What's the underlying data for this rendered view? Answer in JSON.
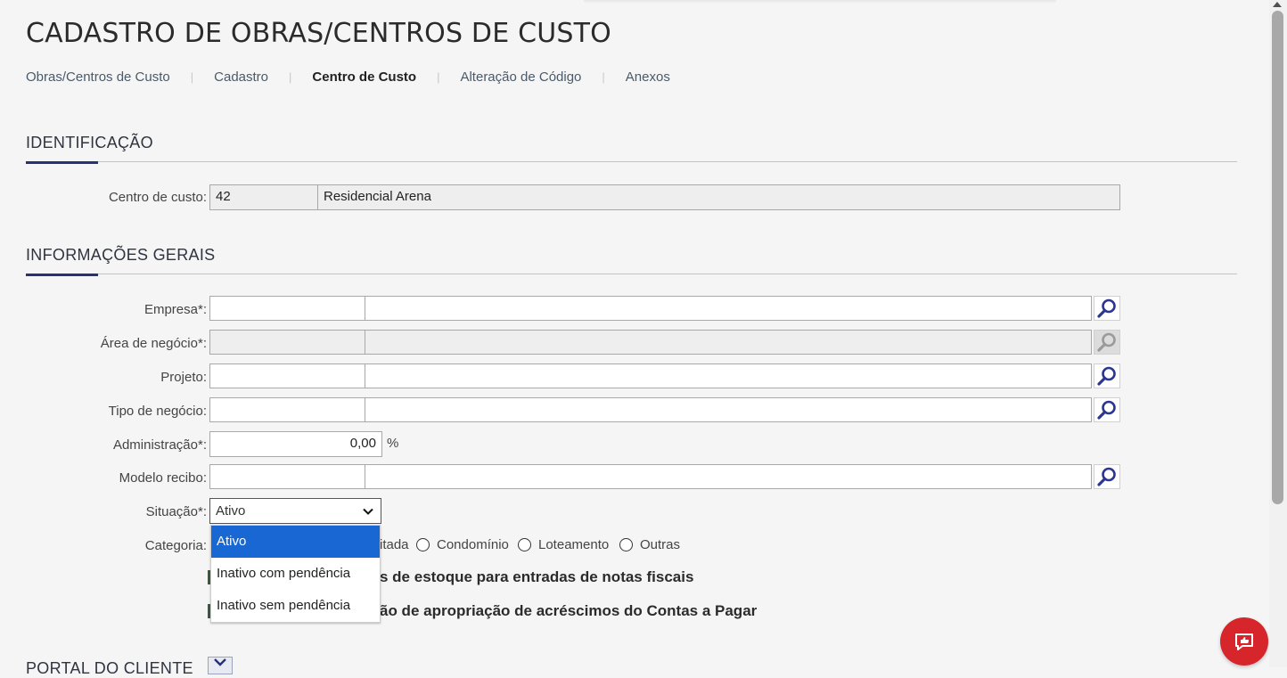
{
  "page": {
    "title": "CADASTRO DE OBRAS/CENTROS DE CUSTO"
  },
  "tabs": [
    {
      "label": "Obras/Centros de Custo",
      "active": false
    },
    {
      "label": "Cadastro",
      "active": false
    },
    {
      "label": "Centro de Custo",
      "active": true
    },
    {
      "label": "Alteração de Código",
      "active": false
    },
    {
      "label": "Anexos",
      "active": false
    }
  ],
  "identificacao": {
    "title": "IDENTIFICAÇÃO",
    "centro_custo_label": "Centro de custo:",
    "centro_custo_code": "42",
    "centro_custo_name": "Residencial Arena"
  },
  "informacoes": {
    "title": "INFORMAÇÕES GERAIS",
    "empresa_label": "Empresa*:",
    "empresa_code": "",
    "empresa_name": "",
    "area_label": "Área de negócio*:",
    "area_code": "",
    "area_name": "",
    "projeto_label": "Projeto:",
    "projeto_code": "",
    "projeto_name": "",
    "tipo_label": "Tipo de negócio:",
    "tipo_code": "",
    "tipo_name": "",
    "administracao_label": "Administração*:",
    "administracao_value": "0,00",
    "percent_symbol": "%",
    "modelo_label": "Modelo recibo:",
    "modelo_code": "",
    "modelo_name": "",
    "situacao_label": "Situação*:",
    "situacao_selected": "Ativo",
    "situacao_options": [
      "Ativo",
      "Inativo com pendência",
      "Inativo sem pendência"
    ],
    "categoria_label": "Categoria:",
    "categoria_partial": "itada",
    "categoria_options": [
      "Condomínio",
      "Loteamento",
      "Outras"
    ],
    "checkbox1_text": "s de estoque para entradas de notas fiscais",
    "checkbox2_text": "ão de apropriação de acréscimos do Contas a Pagar"
  },
  "portal": {
    "title": "PORTAL DO CLIENTE"
  },
  "colors": {
    "accent": "#26317a",
    "select_highlight": "#1967d2",
    "fab": "#d6262b",
    "search_icon": "#2b3690"
  },
  "icons": {
    "lookup": "search-icon",
    "fab": "feedback-icon",
    "portal_toggle": "chevron-down-icon",
    "select_caret": "chevron-down-icon"
  }
}
